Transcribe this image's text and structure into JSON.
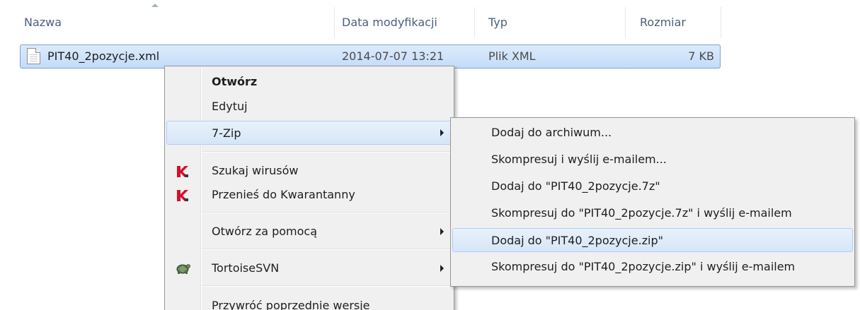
{
  "columns": {
    "name": "Nazwa",
    "modified": "Data modyfikacji",
    "type": "Typ",
    "size": "Rozmiar"
  },
  "file": {
    "name": "PIT40_2pozycje.xml",
    "modified": "2014-07-07 13:21",
    "type": "Plik XML",
    "size": "7 KB"
  },
  "context_menu": {
    "items": [
      {
        "label": "Otwórz"
      },
      {
        "label": "Edytuj"
      },
      {
        "label": "7-Zip"
      },
      {
        "label": "Szukaj wirusów",
        "icon": "kaspersky-icon"
      },
      {
        "label": "Przenieś do Kwarantanny",
        "icon": "kaspersky-icon"
      },
      {
        "label": "Otwórz za pomocą"
      },
      {
        "label": "TortoiseSVN",
        "icon": "tortoisesvn-icon"
      },
      {
        "label": "Przywróć poprzednie wersje"
      }
    ]
  },
  "submenu_7zip": {
    "items": [
      {
        "label": "Dodaj do archiwum..."
      },
      {
        "label": "Skompresuj i wyślij e-mailem..."
      },
      {
        "label": "Dodaj do \"PIT40_2pozycje.7z\""
      },
      {
        "label": "Skompresuj do \"PIT40_2pozycje.7z\" i wyślij e-mailem"
      },
      {
        "label": "Dodaj do \"PIT40_2pozycje.zip\""
      },
      {
        "label": "Skompresuj do \"PIT40_2pozycje.zip\" i wyślij e-mailem"
      }
    ]
  },
  "colors": {
    "header_text": "#4c607a",
    "selection": "#cce0f8",
    "menu_bg": "#f0f0f0",
    "kaspersky_red": "#d4122b"
  }
}
